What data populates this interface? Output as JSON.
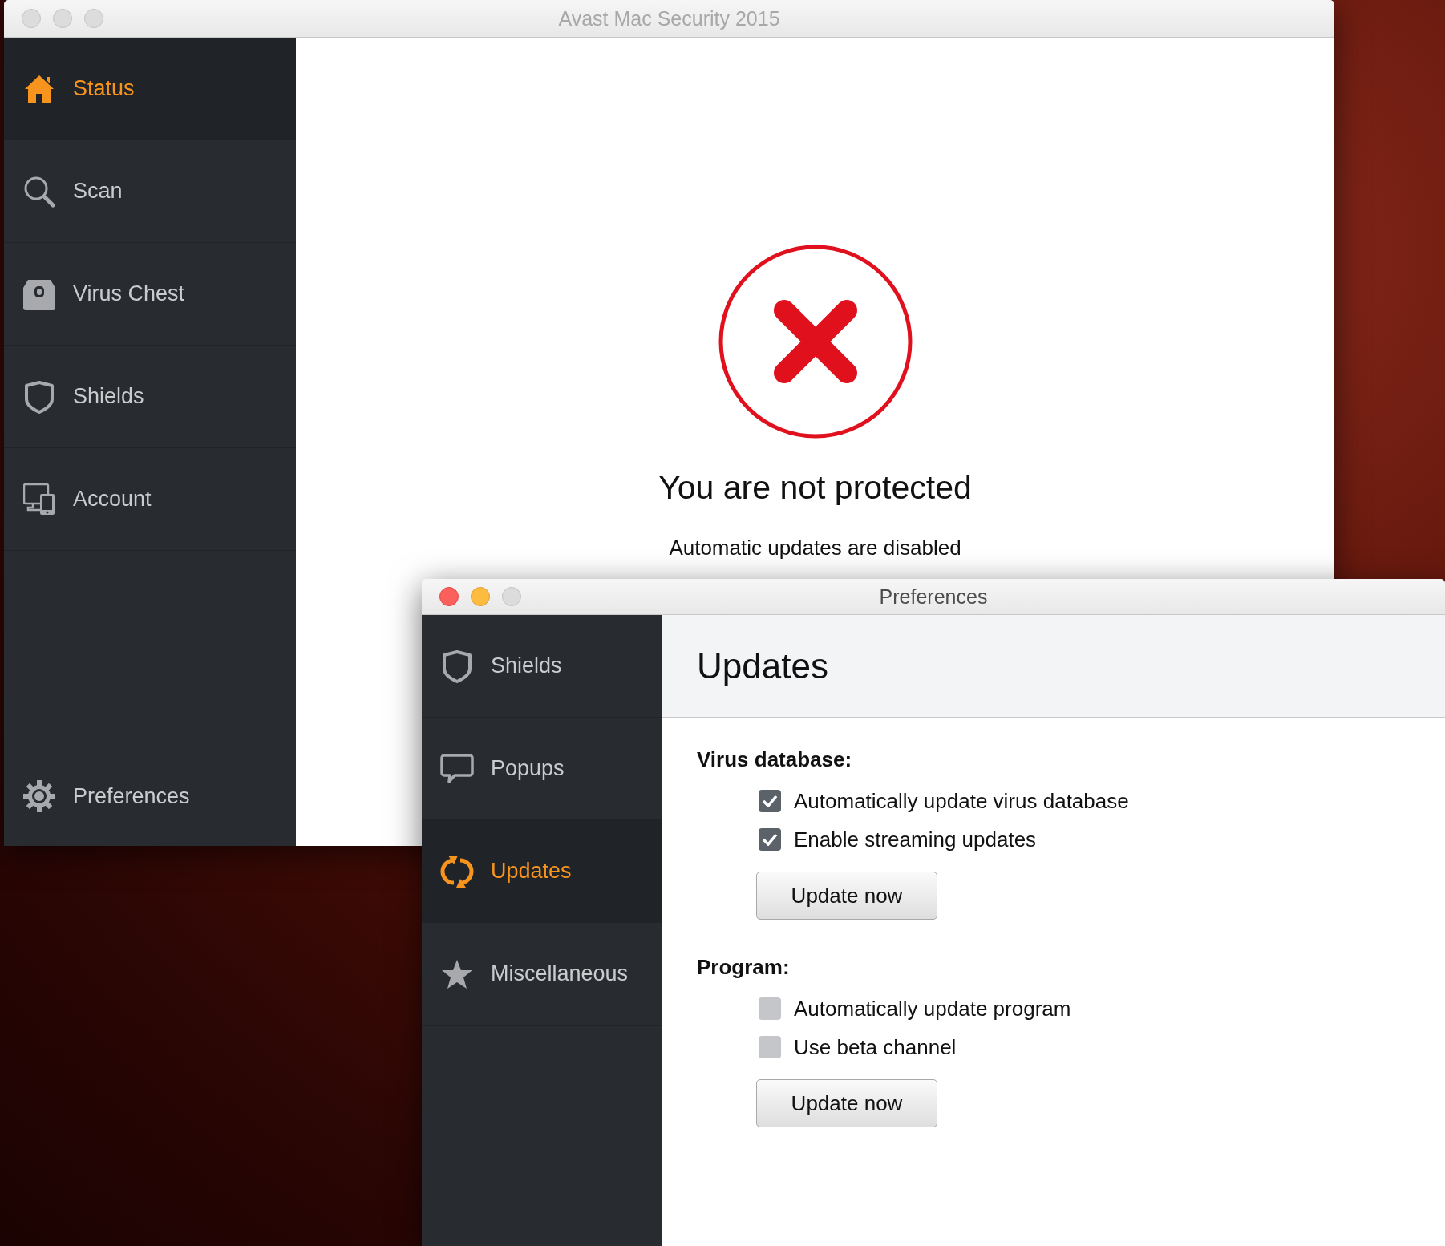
{
  "main_window": {
    "title": "Avast Mac Security 2015",
    "active": false,
    "sidebar": {
      "items": [
        {
          "label": "Status",
          "selected": true
        },
        {
          "label": "Scan",
          "selected": false
        },
        {
          "label": "Virus Chest",
          "selected": false
        },
        {
          "label": "Shields",
          "selected": false
        },
        {
          "label": "Account",
          "selected": false
        }
      ],
      "footer_item": {
        "label": "Preferences",
        "selected": false
      }
    },
    "status": {
      "headline": "You are not protected",
      "message": "Automatic updates are disabled"
    }
  },
  "preferences_window": {
    "title": "Preferences",
    "active": true,
    "sidebar": {
      "items": [
        {
          "label": "Shields",
          "selected": false
        },
        {
          "label": "Popups",
          "selected": false
        },
        {
          "label": "Updates",
          "selected": true
        },
        {
          "label": "Miscellaneous",
          "selected": false
        }
      ]
    },
    "heading": "Updates",
    "sections": [
      {
        "title": "Virus database:",
        "options": [
          {
            "label": "Automatically update virus database",
            "checked": true
          },
          {
            "label": "Enable streaming updates",
            "checked": true
          }
        ],
        "button": "Update now"
      },
      {
        "title": "Program:",
        "options": [
          {
            "label": "Automatically update program",
            "checked": false
          },
          {
            "label": "Use beta channel",
            "checked": false
          }
        ],
        "button": "Update now"
      }
    ]
  }
}
